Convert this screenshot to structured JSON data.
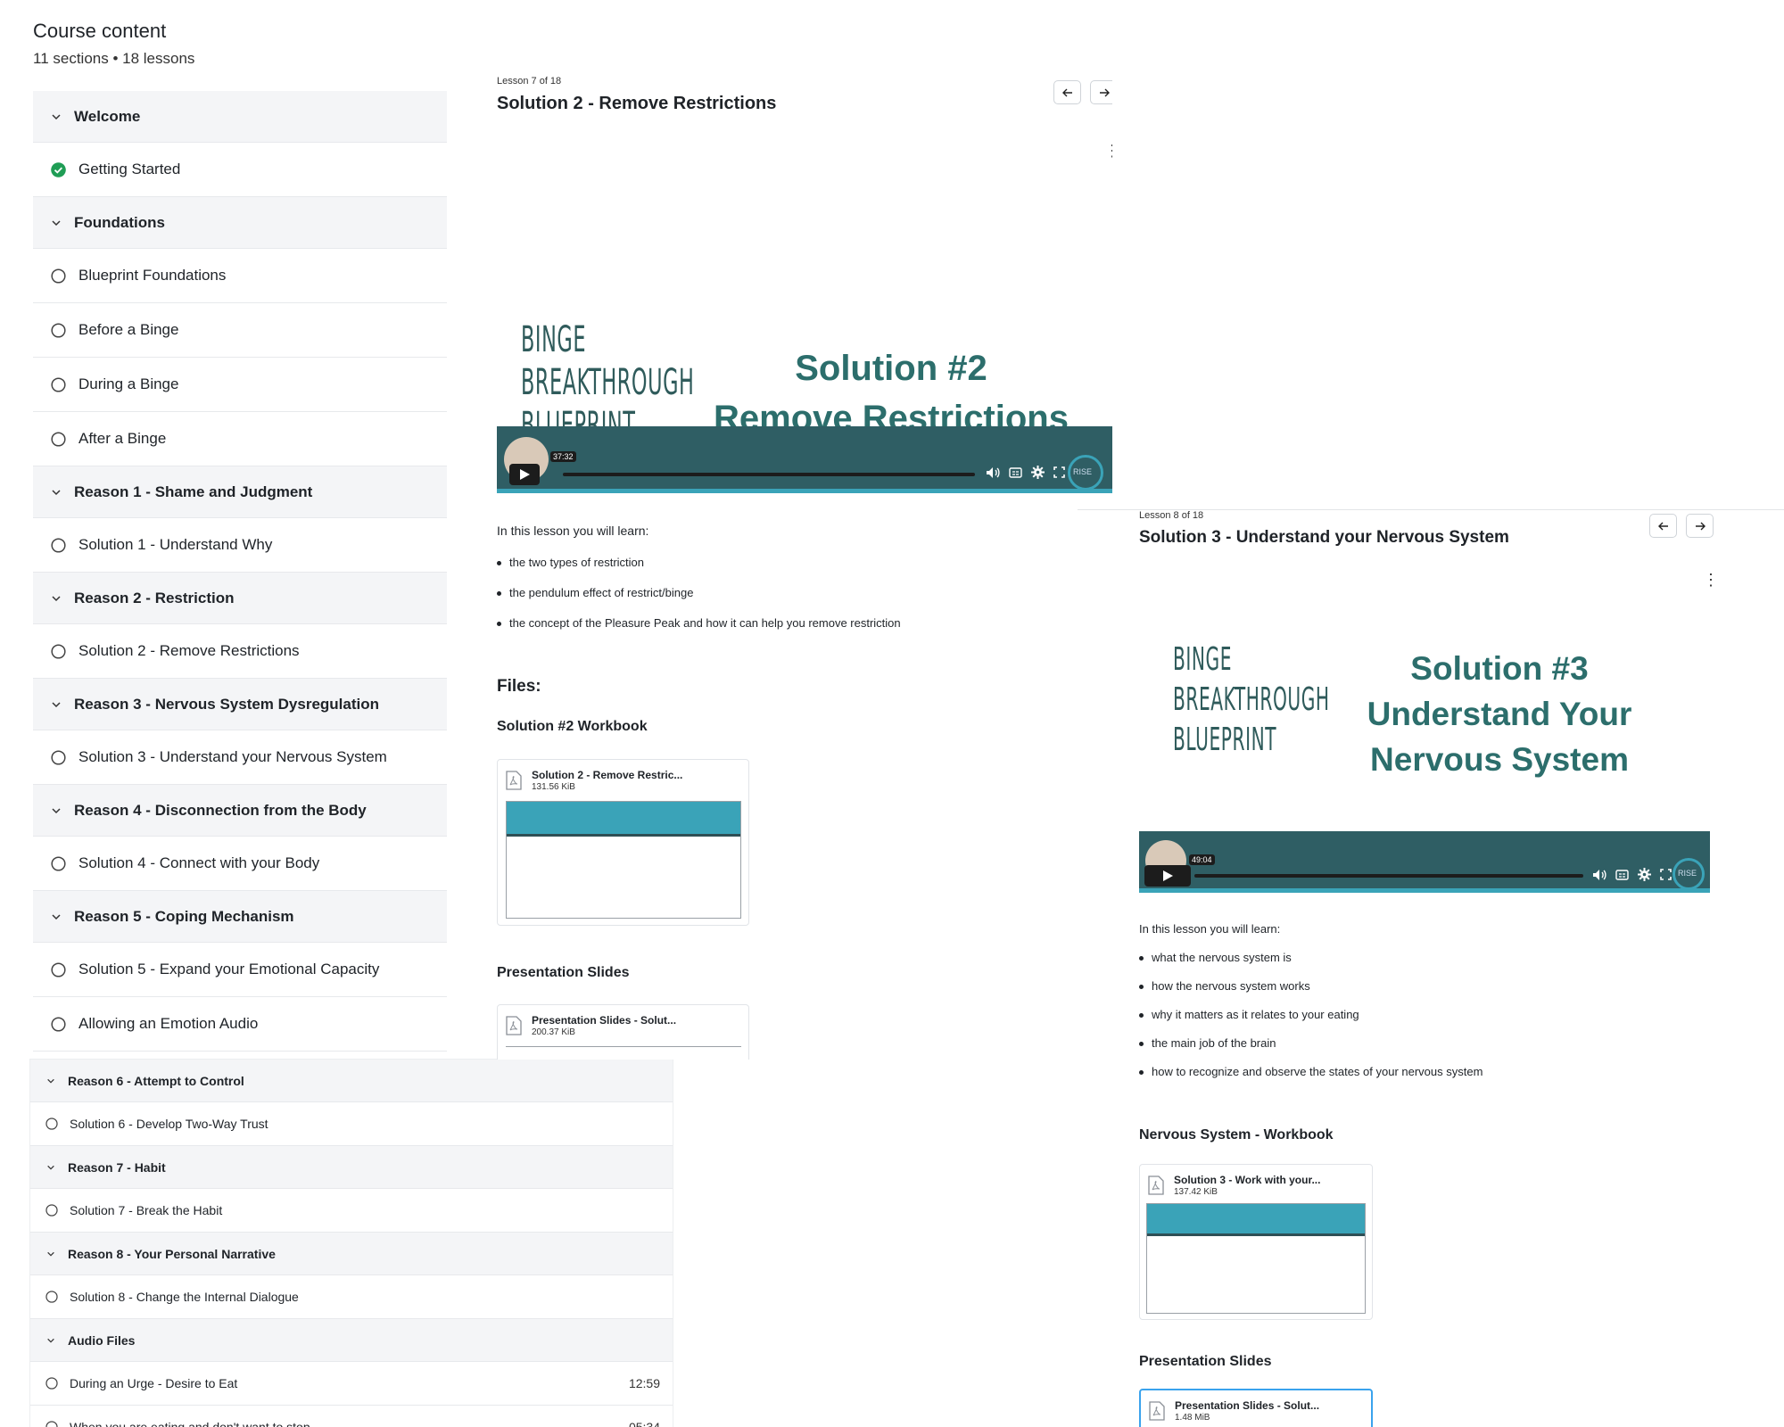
{
  "sidebar": {
    "title": "Course content",
    "subtitle": "11 sections • 18 lessons",
    "top_items": [
      {
        "type": "section",
        "label": "Welcome"
      },
      {
        "type": "lesson",
        "label": "Getting Started",
        "done": true
      },
      {
        "type": "section",
        "label": "Foundations"
      },
      {
        "type": "lesson",
        "label": "Blueprint Foundations"
      },
      {
        "type": "lesson",
        "label": "Before a Binge"
      },
      {
        "type": "lesson",
        "label": "During a Binge"
      },
      {
        "type": "lesson",
        "label": "After a Binge"
      },
      {
        "type": "section",
        "label": "Reason 1 - Shame and Judgment"
      },
      {
        "type": "lesson",
        "label": "Solution 1 - Understand Why"
      },
      {
        "type": "section",
        "label": "Reason 2 - Restriction"
      },
      {
        "type": "lesson",
        "label": "Solution 2 - Remove Restrictions"
      },
      {
        "type": "section",
        "label": "Reason 3 - Nervous System Dysregulation"
      },
      {
        "type": "lesson",
        "label": "Solution 3 - Understand your Nervous System"
      },
      {
        "type": "section",
        "label": "Reason 4 - Disconnection from the Body"
      },
      {
        "type": "lesson",
        "label": "Solution 4 - Connect with your Body"
      },
      {
        "type": "section",
        "label": "Reason 5 - Coping Mechanism"
      },
      {
        "type": "lesson",
        "label": "Solution 5 - Expand your Emotional Capacity"
      },
      {
        "type": "lesson",
        "label": "Allowing an Emotion Audio"
      }
    ],
    "bottom_items": [
      {
        "type": "section",
        "label": "Reason 6 - Attempt to Control"
      },
      {
        "type": "lesson",
        "label": "Solution 6 - Develop Two-Way Trust"
      },
      {
        "type": "section",
        "label": "Reason 7 - Habit"
      },
      {
        "type": "lesson",
        "label": "Solution 7 - Break the Habit"
      },
      {
        "type": "section",
        "label": "Reason 8 - Your Personal Narrative"
      },
      {
        "type": "lesson",
        "label": "Solution 8 - Change the Internal Dialogue"
      },
      {
        "type": "section",
        "label": "Audio Files"
      },
      {
        "type": "lesson",
        "label": "During an Urge - Desire to Eat",
        "duration": "12:59"
      },
      {
        "type": "lesson",
        "label": "When you are eating and don't want to stop",
        "duration": "05:34"
      }
    ]
  },
  "lesson1": {
    "count": "Lesson 7 of 18",
    "title": "Solution 2 - Remove Restrictions",
    "kebab": "⋮",
    "slide": {
      "logo": [
        "BINGE",
        "BREAKTHROUGH",
        "BLUE",
        "PRINT"
      ],
      "line1": "Solution #2",
      "line2": "Remove Restrictions"
    },
    "video": {
      "time": "37:32",
      "watermark": "RISE"
    },
    "learn_intro": "In this lesson you will learn:",
    "bullets": [
      "the two types of restriction",
      "the pendulum effect of restrict/binge",
      "the concept of the Pleasure Peak and how it can help you remove restriction"
    ],
    "files_heading": "Files:",
    "workbook_heading": "Solution #2 Workbook",
    "workbook_file": {
      "name": "Solution 2 - Remove Restric...",
      "size": "131.56 KiB"
    },
    "slides_heading": "Presentation Slides",
    "slides_file": {
      "name": "Presentation Slides - Solut...",
      "size": "200.37 KiB"
    }
  },
  "lesson2": {
    "count": "Lesson 8 of 18",
    "title": "Solution 3 - Understand your Nervous System",
    "kebab": "⋮",
    "slide": {
      "logo": [
        "BINGE",
        "BREAKTHROUGH",
        "BLUE",
        "PRINT"
      ],
      "line1": "Solution #3",
      "line2": "Understand Your",
      "line3": "Nervous System"
    },
    "video": {
      "time": "49:04",
      "watermark": "RISE"
    },
    "learn_intro": "In this lesson you will learn:",
    "bullets": [
      "what the nervous system is",
      "how the nervous system works",
      "why it matters as it relates to your eating",
      "the main job of the brain",
      "how to recognize and observe the states of your nervous system"
    ],
    "workbook_heading": "Nervous System - Workbook",
    "workbook_file": {
      "name": "Solution 3 - Work with your...",
      "size": "137.42 KiB"
    },
    "slides_heading": "Presentation Slides",
    "slides_file": {
      "name": "Presentation Slides - Solut...",
      "size": "1.48 MiB"
    }
  },
  "colors": {
    "accent_teal": "#2c6e6c",
    "accent_blue": "#3aa3b8",
    "check_green": "#1f9d55",
    "section_bg": "#f4f5f7"
  },
  "icons": [
    "chevron-down-icon",
    "check-circle-icon",
    "circle-icon",
    "arrow-left-icon",
    "arrow-right-icon",
    "kebab-menu-icon",
    "play-icon",
    "volume-icon",
    "captions-icon",
    "settings-icon",
    "fullscreen-icon",
    "pdf-file-icon"
  ]
}
